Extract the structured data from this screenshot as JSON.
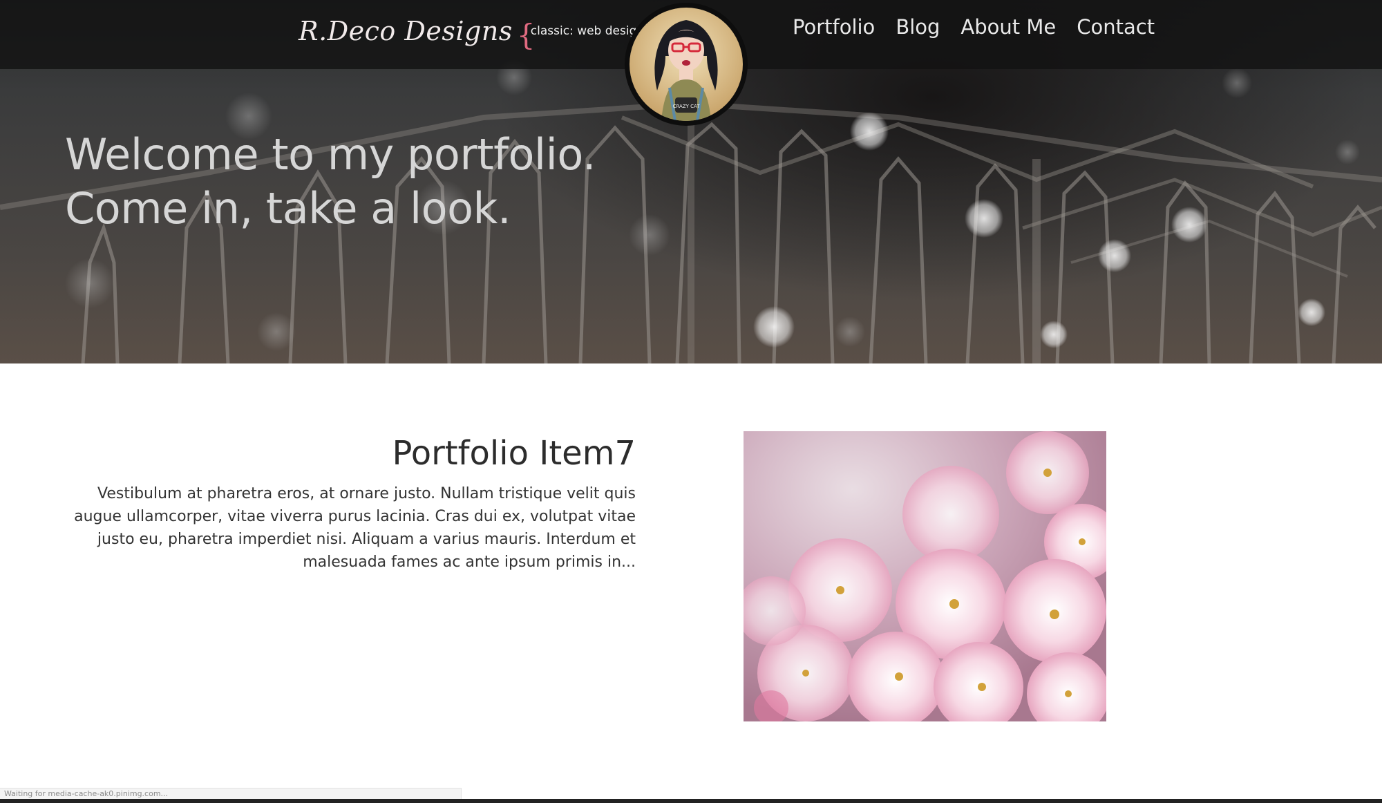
{
  "header": {
    "logo_text": "R.Deco Designs",
    "tagline": "classic: web design;",
    "nav": [
      {
        "label": "Portfolio"
      },
      {
        "label": "Blog"
      },
      {
        "label": "About Me"
      },
      {
        "label": "Contact"
      }
    ],
    "avatar_badge": "CRAZY CAT"
  },
  "hero": {
    "line1": "Welcome to my portfolio.",
    "line2": "Come in, take a look."
  },
  "portfolio_item": {
    "title": "Portfolio Item7",
    "description": "Vestibulum at pharetra eros, at ornare justo. Nullam tristique velit quis augue ullamcorper, vitae viverra purus lacinia. Cras dui ex, volutpat vitae justo eu, pharetra imperdiet nisi. Aliquam a varius mauris. Interdum et malesuada fames ac ante ipsum primis in..."
  },
  "status_bar": {
    "text": "Waiting for media-cache-ak0.pinimg.com..."
  },
  "colors": {
    "topbar": "#121212",
    "nav_text": "#e9e9e9",
    "hero_text": "#d6d6d6",
    "accent_pink": "#e06a80",
    "blossom": "#f3c9d8"
  }
}
